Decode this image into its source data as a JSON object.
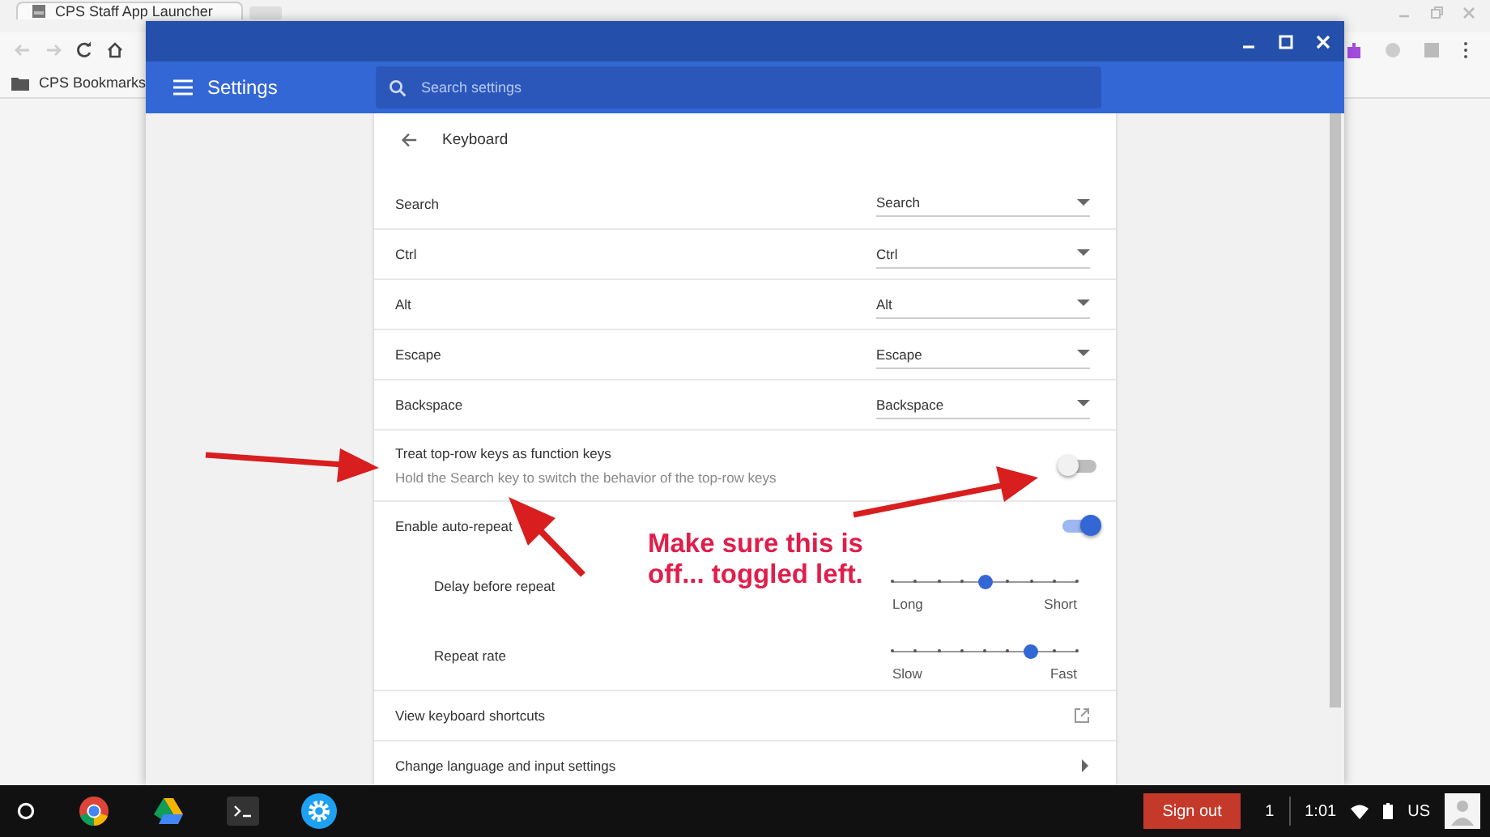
{
  "browser": {
    "tab": {
      "title": "CPS Staff App Launcher"
    },
    "bookmarks": [
      {
        "label": "CPS Bookmarks"
      }
    ]
  },
  "window": {
    "title": "Settings",
    "search": {
      "placeholder": "Search settings"
    }
  },
  "page": {
    "title": "Keyboard",
    "rows": [
      {
        "kind": "select",
        "label": "Search",
        "value": "Search"
      },
      {
        "kind": "select",
        "label": "Ctrl",
        "value": "Ctrl"
      },
      {
        "kind": "select",
        "label": "Alt",
        "value": "Alt"
      },
      {
        "kind": "select",
        "label": "Escape",
        "value": "Escape"
      },
      {
        "kind": "select",
        "label": "Backspace",
        "value": "Backspace"
      },
      {
        "kind": "toggle",
        "label": "Treat top-row keys as function keys",
        "description": "Hold the Search key to switch the behavior of the top-row keys",
        "on": false
      },
      {
        "kind": "toggle",
        "label": "Enable auto-repeat",
        "on": true
      },
      {
        "kind": "slider",
        "label": "Delay before repeat",
        "level": 0.5,
        "min_label": "Long",
        "max_label": "Short"
      },
      {
        "kind": "slider",
        "label": "Repeat rate",
        "level": 0.75,
        "min_label": "Slow",
        "max_label": "Fast"
      },
      {
        "kind": "link",
        "label": "View keyboard shortcuts"
      },
      {
        "kind": "submenu",
        "label": "Change language and input settings"
      }
    ]
  },
  "annotation": {
    "lines": [
      "Make sure this is",
      "off... toggled left."
    ]
  },
  "taskbar": {
    "sign_out": "Sign out",
    "notifications": "1",
    "time": "1:01",
    "keyboard": "US"
  }
}
